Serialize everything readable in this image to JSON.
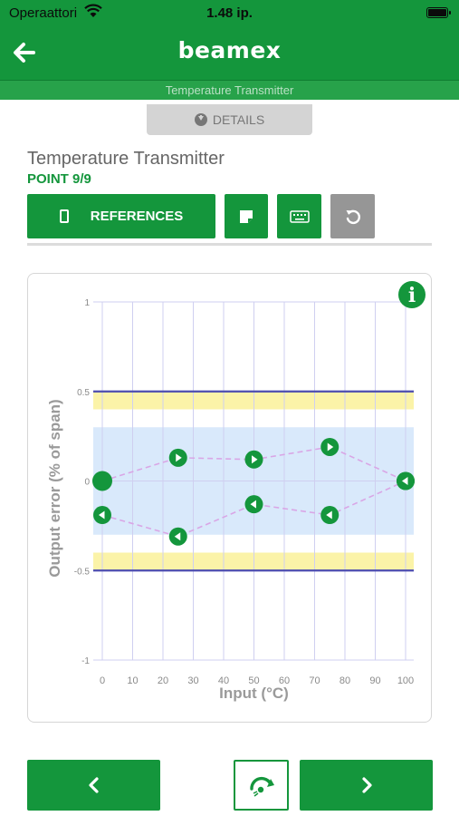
{
  "status": {
    "carrier": "Operaattori",
    "time": "1.48 ip."
  },
  "header": {
    "logo": "beamex",
    "subtitle": "Temperature Transmitter"
  },
  "details": {
    "label": "DETAILS"
  },
  "instrument": {
    "title": "Temperature Transmitter",
    "point": "POINT 9/9"
  },
  "toolbar": {
    "references_label": "REFERENCES"
  },
  "colors": {
    "brand_green": "#14963c",
    "limit_line": "#4c4cb0",
    "warning_band": "#fbf3a8",
    "tolerance_band": "#d9e9fb",
    "series_line": "#d9a6e6"
  },
  "chart_data": {
    "type": "scatter",
    "xlabel": "Input (°C)",
    "ylabel": "Output error (% of span)",
    "xlim": [
      0,
      100
    ],
    "ylim": [
      -1,
      1
    ],
    "x_ticks": [
      "0",
      "10",
      "20",
      "30",
      "40",
      "50",
      "60",
      "70",
      "80",
      "90",
      "100"
    ],
    "y_ticks": [
      "1",
      "0.5",
      "0",
      "-0.5",
      "-1"
    ],
    "limits": [
      0.5,
      -0.5
    ],
    "warning_bands": [
      [
        0.4,
        0.5
      ],
      [
        -0.5,
        -0.4
      ]
    ],
    "tolerance_band": [
      -0.3,
      0.3
    ],
    "grid": true,
    "series": [
      {
        "direction": "up",
        "x": [
          0,
          25,
          50,
          75,
          100
        ],
        "y": [
          0,
          0.13,
          0.12,
          0.19,
          0
        ]
      },
      {
        "direction": "down",
        "x": [
          0,
          25,
          50,
          75,
          100
        ],
        "y": [
          -0.19,
          -0.31,
          -0.13,
          -0.19,
          0
        ]
      }
    ]
  },
  "icons": {
    "info": "info-icon",
    "back": "arrow-left-icon",
    "prev": "chevron-left-icon",
    "next": "chevron-right-icon"
  },
  "info_symbol": "i"
}
